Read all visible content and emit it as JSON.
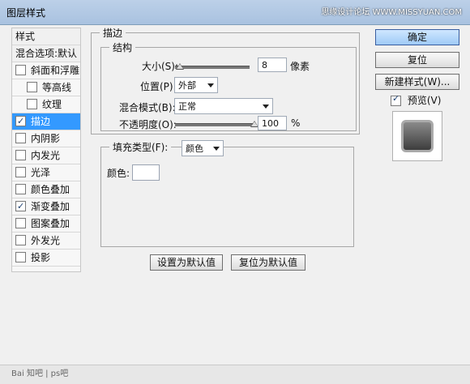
{
  "window": {
    "title": "图层样式"
  },
  "watermarks": {
    "top": "思缘设计论坛 WWW.MISSYUAN.COM",
    "bottom": "Bai 知吧 | ps吧"
  },
  "sidebar": {
    "items": [
      {
        "label": "样式",
        "type": "header"
      },
      {
        "label": "混合选项:默认",
        "type": "header"
      },
      {
        "label": "斜面和浮雕",
        "checked": false
      },
      {
        "label": "等高线",
        "checked": false,
        "indent": true
      },
      {
        "label": "纹理",
        "checked": false,
        "indent": true
      },
      {
        "label": "描边",
        "checked": true,
        "active": true
      },
      {
        "label": "内阴影",
        "checked": false
      },
      {
        "label": "内发光",
        "checked": false
      },
      {
        "label": "光泽",
        "checked": false
      },
      {
        "label": "颜色叠加",
        "checked": false
      },
      {
        "label": "渐变叠加",
        "checked": true
      },
      {
        "label": "图案叠加",
        "checked": false
      },
      {
        "label": "外发光",
        "checked": false
      },
      {
        "label": "投影",
        "checked": false
      }
    ]
  },
  "stroke": {
    "section_title": "描边",
    "structure_title": "结构",
    "size": {
      "label": "大小(S):",
      "value": "8",
      "unit": "像素",
      "fraction": 0.06
    },
    "position": {
      "label": "位置(P):",
      "value": "外部"
    },
    "blend_mode": {
      "label": "混合模式(B):",
      "value": "正常"
    },
    "opacity": {
      "label": "不透明度(O):",
      "value": "100",
      "unit": "%",
      "fraction": 1.0
    },
    "fill_type": {
      "label": "填充类型(F):",
      "value": "颜色"
    },
    "color": {
      "label": "颜色:",
      "value": "#ffffff"
    }
  },
  "buttons": {
    "ok": "确定",
    "reset": "复位",
    "new_style": "新建样式(W)...",
    "set_default": "设置为默认值",
    "reset_default": "复位为默认值"
  },
  "preview": {
    "label": "预览(V)",
    "checked": true
  }
}
